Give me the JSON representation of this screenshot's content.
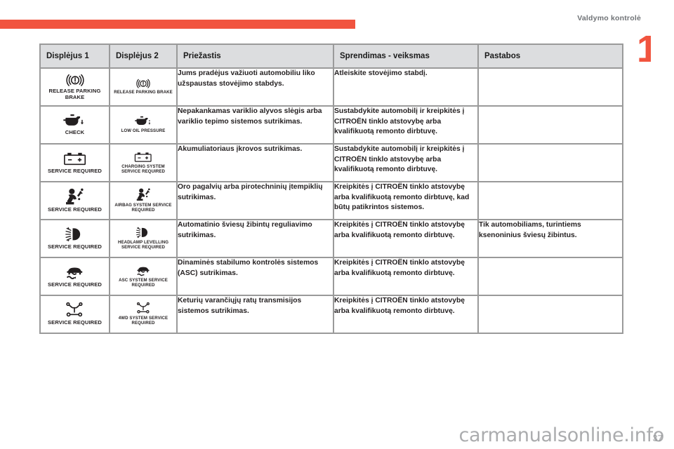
{
  "header": {
    "chapter_title": "Valdymo kontrolė",
    "chapter_number": "1",
    "accent_color": "#f1543f"
  },
  "table": {
    "columns": [
      "Displėjus 1",
      "Displėjus 2",
      "Priežastis",
      "Sprendimas - veiksmas",
      "Pastabos"
    ],
    "rows": [
      {
        "icon1": "parking-brake-warning-icon",
        "label1": "RELEASE PARKING BRAKE",
        "icon2": "parking-brake-warning-icon",
        "label2": "RELEASE PARKING BRAKE",
        "cause": "Jums pradėjus važiuoti automobiliu liko užspaustas stovėjimo stabdys.",
        "solution": "Atleiskite stovėjimo stabdį.",
        "notes": ""
      },
      {
        "icon1": "oil-can-check-icon",
        "label1": "CHECK",
        "icon2": "oil-can-low-pressure-icon",
        "label2": "LOW OIL PRESSURE",
        "cause": "Nepakankamas variklio alyvos slėgis arba variklio tepimo sistemos sutrikimas.",
        "solution": "Sustabdykite automobilį ir kreipkitės į CITROËN tinklo atstovybę arba kvalifikuotą remonto dirbtuvę.",
        "notes": ""
      },
      {
        "icon1": "battery-icon",
        "label1": "SERVICE REQUIRED",
        "icon2": "battery-icon",
        "label2": "CHARGING SYSTEM SERVICE REQUIRED",
        "cause": "Akumuliatoriaus įkrovos sutrikimas.",
        "solution": "Sustabdykite automobilį ir kreipkitės į CITROËN tinklo atstovybę arba kvalifikuotą remonto dirbtuvę.",
        "notes": ""
      },
      {
        "icon1": "airbag-icon",
        "label1": "SERVICE REQUIRED",
        "icon2": "airbag-icon",
        "label2": "AIRBAG SYSTEM SERVICE REQUIRED",
        "cause": "Oro pagalvių arba pirotechninių įtempiklių sutrikimas.",
        "solution": "Kreipkitės į CITROËN tinklo atstovybę arba kvalifikuotą remonto dirbtuvę, kad būtų patikrintos sistemos.",
        "notes": ""
      },
      {
        "icon1": "headlamp-levelling-icon",
        "label1": "SERVICE REQUIRED",
        "icon2": "headlamp-levelling-icon",
        "label2": "HEADLAMP LEVELLING SERVICE REQUIRED",
        "cause": "Automatinio šviesų žibintų reguliavimo sutrikimas.",
        "solution": "Kreipkitės į CITROËN tinklo atstovybę arba kvalifikuotą remonto dirbtuvę.",
        "notes": "Tik automobiliams, turintiems ksenoninius šviesų žibintus."
      },
      {
        "icon1": "asc-stability-icon",
        "label1": "SERVICE REQUIRED",
        "icon2": "asc-stability-icon",
        "label2": "ASC SYSTEM SERVICE REQUIRED",
        "cause": "Dinaminės stabilumo kontrolės sistemos (ASC) sutrikimas.",
        "solution": "Kreipkitės į CITROËN tinklo atstovybę arba kvalifikuotą remonto dirbtuvę.",
        "notes": ""
      },
      {
        "icon1": "four-wheel-drive-icon",
        "label1": "SERVICE REQUIRED",
        "icon2": "four-wheel-drive-icon",
        "label2": "4WD SYSTEM SERVICE REQUIRED",
        "cause": "Keturių varančiųjų ratų transmisijos sistemos sutrikimas.",
        "solution": "Kreipkitės į CITROËN tinklo atstovybę arba kvalifikuotą remonto dirbtuvę.",
        "notes": ""
      }
    ]
  },
  "footer": {
    "page_number": "37",
    "watermark": "carmanualsonline.info"
  }
}
